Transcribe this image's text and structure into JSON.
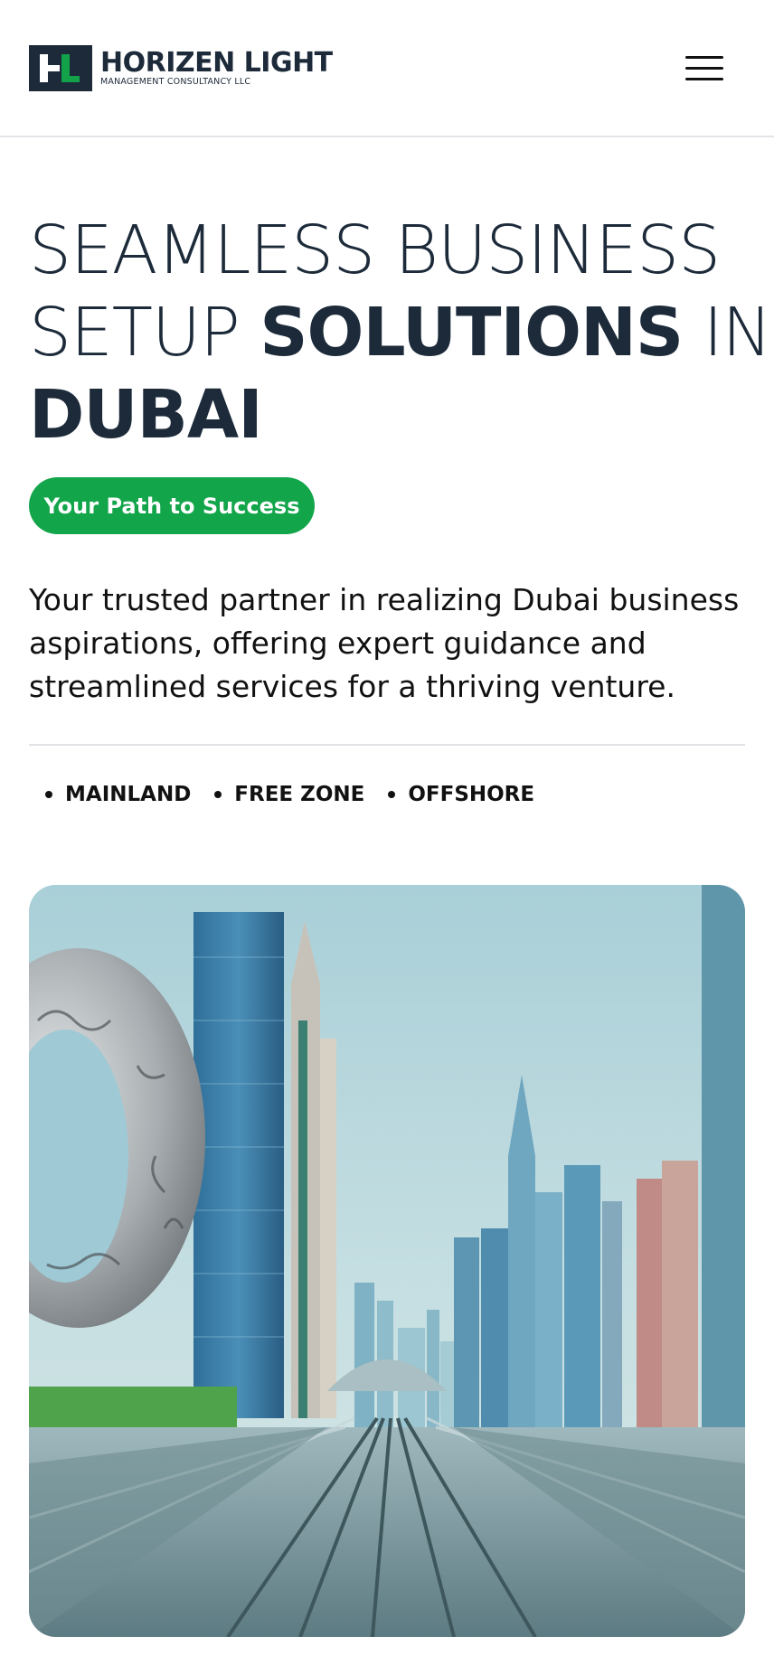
{
  "header": {
    "logo_title": "HORIZEN LIGHT",
    "logo_subtitle": "MANAGEMENT CONSULTANCY LLC",
    "menu_icon": "hamburger-menu-icon"
  },
  "hero": {
    "line1": "SEAMLESS BUSINESS",
    "line2_light": "SETUP ",
    "line2_bold": "SOLUTIONS",
    "line2_light_end": " IN",
    "line3_bold": "DUBAI",
    "cta_label": "Your Path to Success",
    "lead": "Your trusted partner in realizing Dubai business aspirations, offering expert guidance and streamlined services for a thriving venture."
  },
  "tags": [
    "MAINLAND",
    "FREE ZONE",
    "OFFSHORE"
  ],
  "colors": {
    "brand_navy": "#1c2a3a",
    "brand_green": "#12a54a"
  }
}
